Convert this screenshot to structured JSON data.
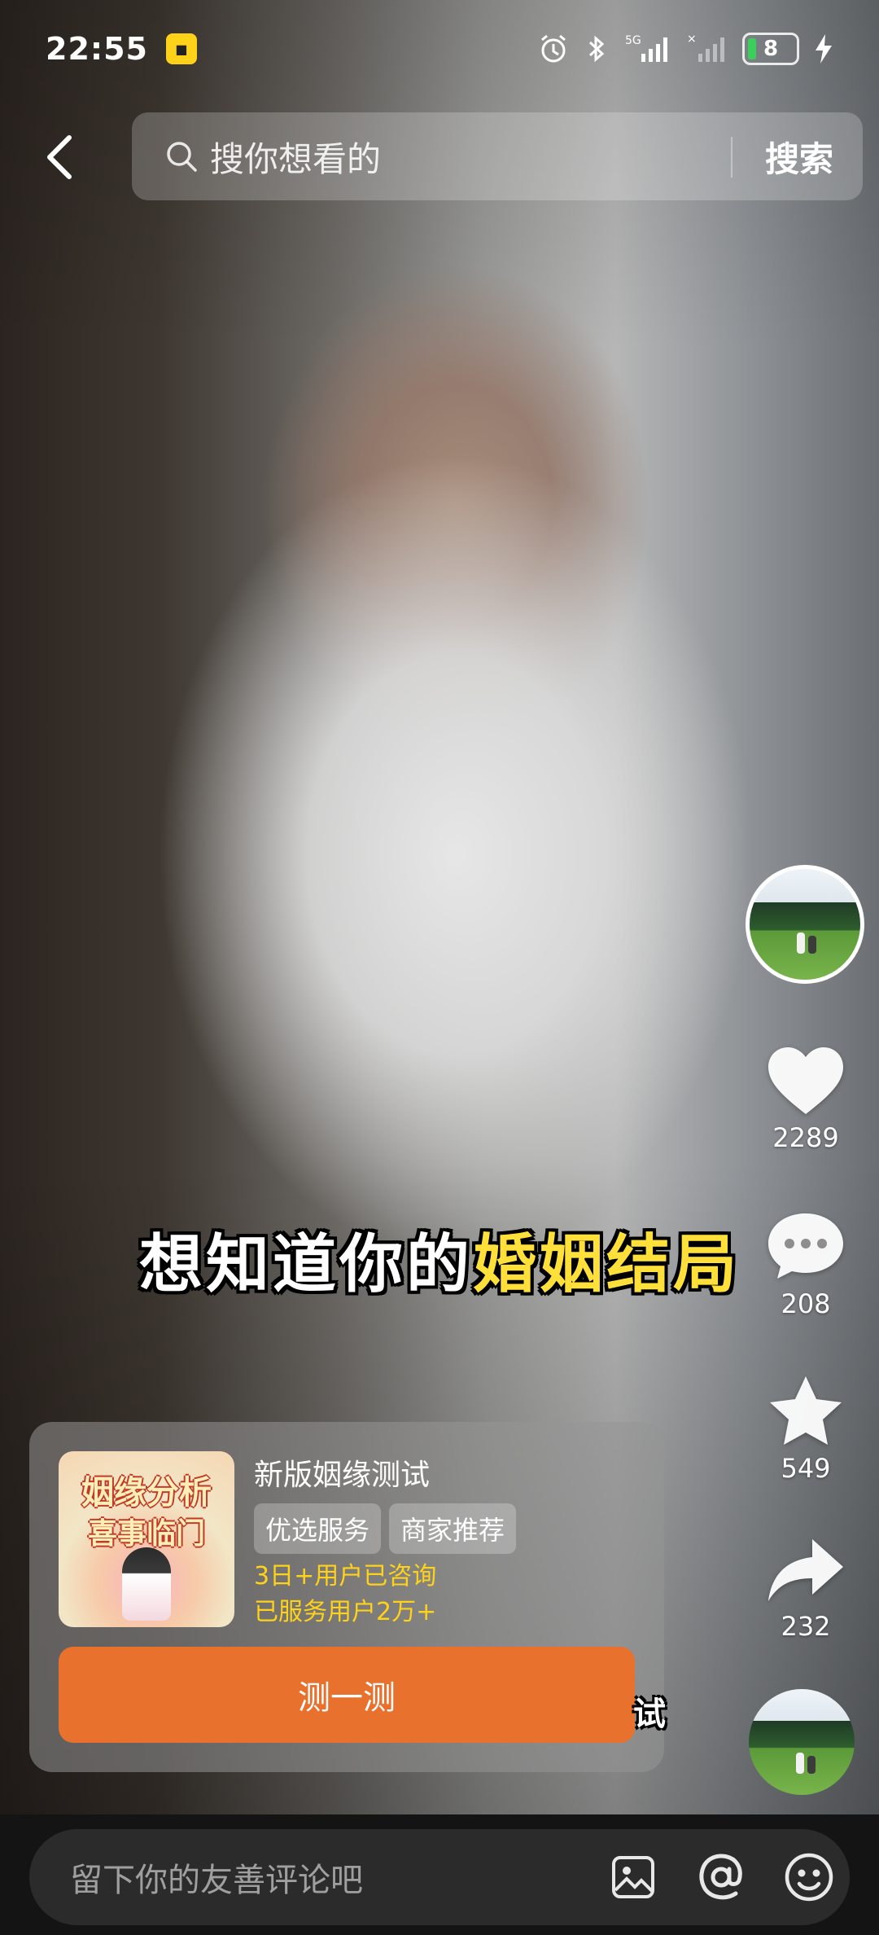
{
  "status_bar": {
    "time": "22:55",
    "app_badge_icon": "app-badge",
    "network": "5G",
    "battery_level": "8",
    "battery_color": "#3ad15a"
  },
  "search": {
    "placeholder": "搜你想看的",
    "button_label": "搜索"
  },
  "video": {
    "caption_prefix": "想知道你的",
    "caption_highlight": "婚姻结局",
    "caption_highlight_color": "#ffe03a",
    "partial_caption": "试"
  },
  "actions": {
    "likes": "2289",
    "comments": "208",
    "favorites": "549",
    "shares": "232"
  },
  "product_card": {
    "thumbnail_text_1": "姻缘分析",
    "thumbnail_text_2": "喜事临门",
    "title": "新版姻缘测试",
    "tags": [
      "优选服务",
      "商家推荐"
    ],
    "scroll_lines": [
      "3日+用户已咨询",
      "已服务用户2万+"
    ],
    "cta_label": "测一测",
    "cta_color": "#e8712d"
  },
  "comment_bar": {
    "placeholder": "留下你的友善评论吧",
    "icons": [
      "image-icon",
      "at-icon",
      "emoji-icon"
    ]
  }
}
